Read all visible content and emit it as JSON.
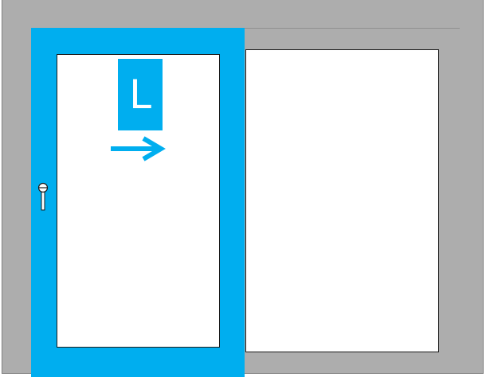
{
  "panel": {
    "badge_label": "L",
    "accent_color": "#00aeef",
    "frame_color": "#adadad",
    "direction": "right",
    "arrow_icon": "arrow-right-icon",
    "handle_icon": "handle-icon"
  }
}
